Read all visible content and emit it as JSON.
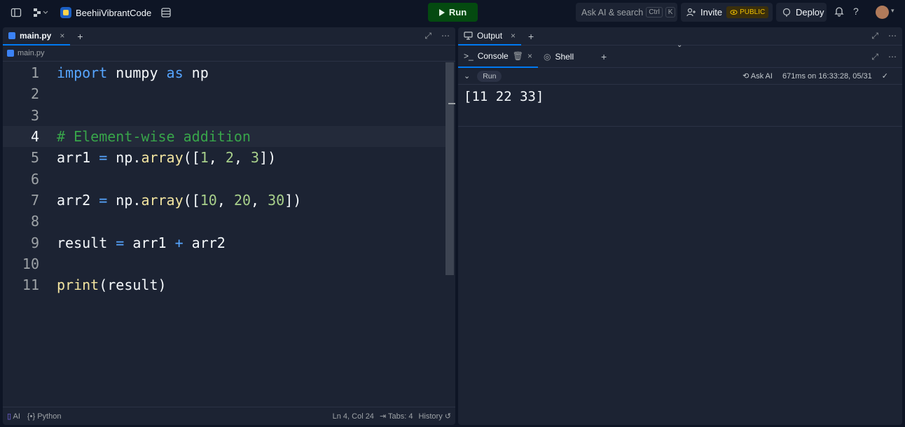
{
  "topbar": {
    "repl_name": "BeehiiVibrantCode",
    "run_label": "Run",
    "search_placeholder": "Ask AI & search",
    "search_key1": "Ctrl",
    "search_key2": "K",
    "invite_label": "Invite",
    "public_label": "PUBLIC",
    "deploy_label": "Deploy",
    "help_label": "?"
  },
  "editor": {
    "tab_label": "main.py",
    "breadcrumb": "main.py",
    "lines": [
      {
        "n": "1"
      },
      {
        "n": "2"
      },
      {
        "n": "3"
      },
      {
        "n": "4"
      },
      {
        "n": "5"
      },
      {
        "n": "6"
      },
      {
        "n": "7"
      },
      {
        "n": "8"
      },
      {
        "n": "9"
      },
      {
        "n": "10"
      },
      {
        "n": "11"
      }
    ],
    "code": {
      "l1_a": "import",
      "l1_b": " numpy ",
      "l1_c": "as",
      "l1_d": " np",
      "l4": "# Element-wise addition",
      "l5_a": "arr1 ",
      "l5_b": "=",
      "l5_c": " np.",
      "l5_d": "array",
      "l5_e": "([",
      "l5_f": "1",
      "l5_g": ", ",
      "l5_h": "2",
      "l5_i": ", ",
      "l5_j": "3",
      "l5_k": "])",
      "l7_a": "arr2 ",
      "l7_b": "=",
      "l7_c": " np.",
      "l7_d": "array",
      "l7_e": "([",
      "l7_f": "10",
      "l7_g": ", ",
      "l7_h": "20",
      "l7_i": ", ",
      "l7_j": "30",
      "l7_k": "])",
      "l9_a": "result ",
      "l9_b": "=",
      "l9_c": " arr1 ",
      "l9_d": "+",
      "l9_e": " arr2",
      "l11_a": "print",
      "l11_b": "(result)"
    },
    "status": {
      "ai": "AI",
      "lang": "Python",
      "position": "Ln 4, Col 24",
      "tabs": "Tabs: 4",
      "history": "History"
    }
  },
  "output": {
    "tab_label": "Output",
    "console_label": "Console",
    "shell_label": "Shell",
    "run_chip": "Run",
    "ask_ai": "Ask AI",
    "run_meta": "671ms on 16:33:28, 05/31",
    "console_text": "[11 22 33]"
  },
  "colors": {
    "accent": "#0079f2",
    "run_button": "#044a10",
    "public_badge": "#f0c000"
  }
}
